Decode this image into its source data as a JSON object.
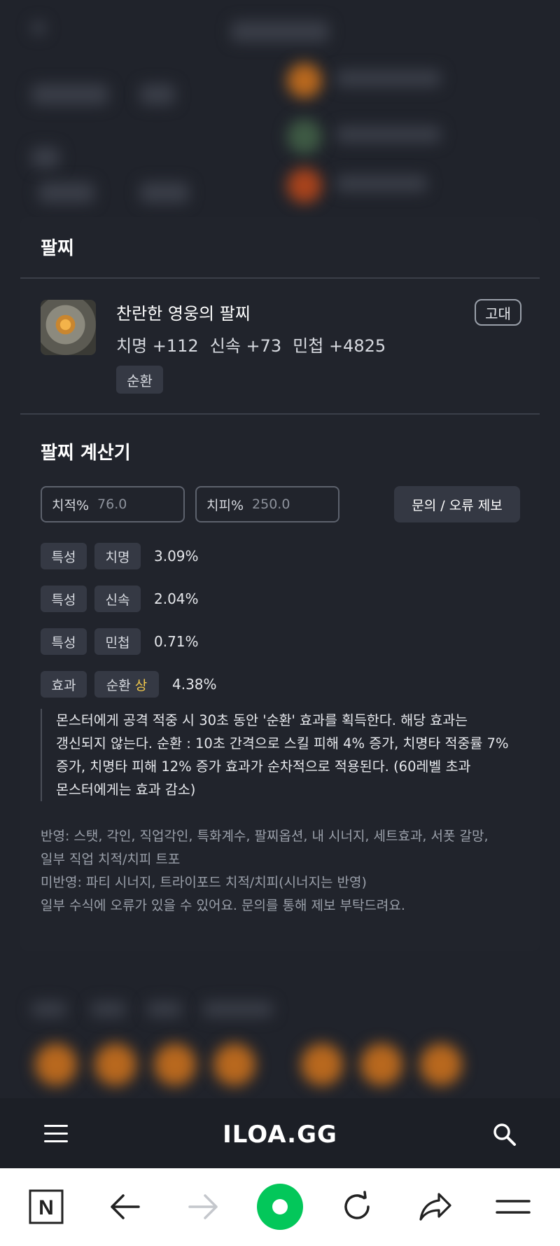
{
  "bracelet_section": {
    "title": "팔찌",
    "item": {
      "name": "찬란한 영웅의 팔찌",
      "grade": "고대",
      "stats": [
        "치명 +112",
        "신속 +73",
        "민첩 +4825"
      ],
      "tag": "순환",
      "icon": "bracelet-item-icon"
    }
  },
  "calculator": {
    "title": "팔찌 계산기",
    "crit_rate": {
      "label": "치적%",
      "value": "76.0"
    },
    "crit_damage": {
      "label": "치피%",
      "value": "250.0"
    },
    "report_button": "문의 / 오류 제보",
    "options": [
      {
        "type": "특성",
        "name": "치명",
        "value": "3.09%"
      },
      {
        "type": "특성",
        "name": "신속",
        "value": "2.04%"
      },
      {
        "type": "특성",
        "name": "민첩",
        "value": "0.71%"
      },
      {
        "type": "효과",
        "name": "순환",
        "grade": "상",
        "value": "4.38%"
      }
    ],
    "effect_description": [
      "몬스터에게 공격 적중 시 30초 동안 '순환' 효과를 획득한다. 해당 효과는",
      "갱신되지 않는다. 순환 : 10초 간격으로 스킬 피해 4% 증가, 치명타 적중률 7%",
      "증가, 치명타 피해 12% 증가 효과가 순차적으로 적용된다. (60레벨 초과",
      "몬스터에게는 효과 감소)"
    ],
    "notes": [
      "반영: 스탯, 각인, 직업각인, 특화계수, 팔찌옵션, 내 시너지, 세트효과, 서폿 갈망,",
      "일부 직업 치적/치피 트포",
      "미반영: 파티 시너지, 트라이포드 치적/치피(시너지는 반영)",
      "일부 수식에 오류가 있을 수 있어요. 문의를 통해 제보 부탁드려요."
    ]
  },
  "site_nav": {
    "logo": "ILOA.GG",
    "menu_icon": "hamburger-menu-icon",
    "search_icon": "search-icon"
  },
  "browser_toolbar": {
    "icons": [
      "naver-n-icon",
      "back-arrow-icon",
      "forward-arrow-icon",
      "green-home-icon",
      "reload-icon",
      "share-icon",
      "menu-lines-icon"
    ],
    "accent": "#03c75a"
  }
}
